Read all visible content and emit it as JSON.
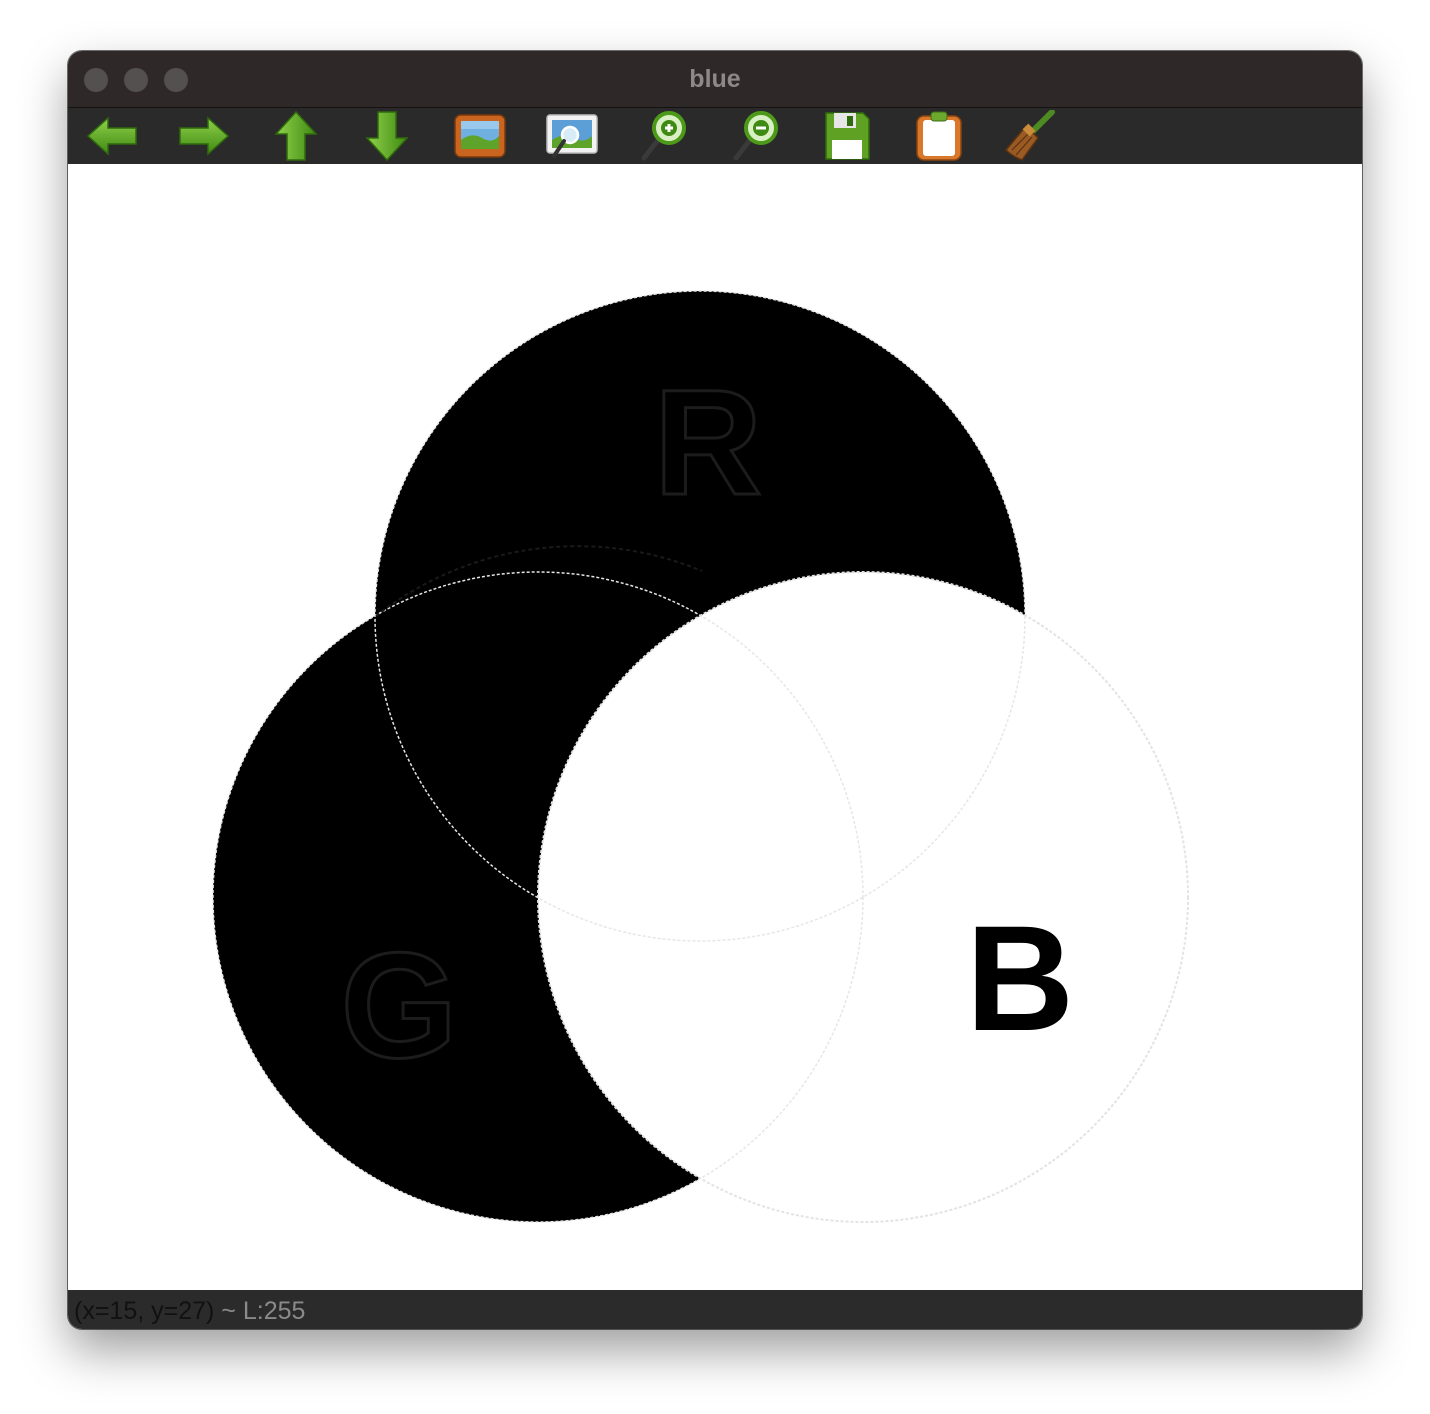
{
  "window": {
    "title": "blue"
  },
  "toolbar": {
    "buttons": [
      {
        "icon": "arrow-left-icon"
      },
      {
        "icon": "arrow-right-icon"
      },
      {
        "icon": "arrow-up-icon"
      },
      {
        "icon": "arrow-down-icon"
      },
      {
        "icon": "image-icon"
      },
      {
        "icon": "zoom-fit-icon"
      },
      {
        "icon": "zoom-in-icon"
      },
      {
        "icon": "zoom-out-icon"
      },
      {
        "icon": "save-icon"
      },
      {
        "icon": "clipboard-icon"
      },
      {
        "icon": "broom-icon"
      }
    ]
  },
  "canvas": {
    "labels": {
      "r": "R",
      "g": "G",
      "b": "B"
    }
  },
  "status": {
    "coords": "(x=15, y=27)",
    "luminance": " ~ L:255"
  },
  "colors": {
    "titlebar": "#2f2829",
    "toolbar": "#2a2a2a",
    "icon_green": "#5fa223",
    "ink": "#000000",
    "paper": "#ffffff"
  }
}
